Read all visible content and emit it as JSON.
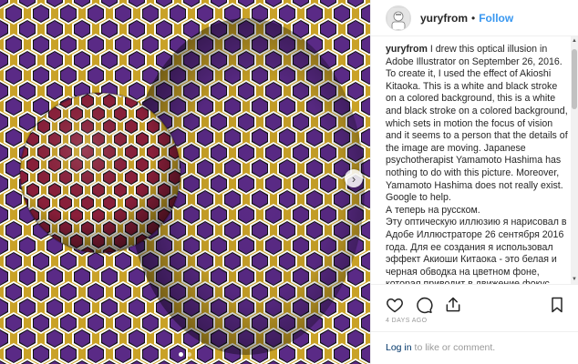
{
  "post": {
    "username": "yuryfrom",
    "separator": "•",
    "follow_label": "Follow",
    "caption_text": "I drew this optical illusion in Adobe Illustrator on September 26, 2016. To create it, I used the effect of Akioshi Kitaoka. This is a white and black stroke on a colored background, this is a white and black stroke on a colored background, which sets in motion the focus of vision and it seems to a person that the details of the image are moving. Japanese psychotherapist Yamamoto Hashima has nothing to do with this picture. Moreover, Yamamoto Hashima does not really exist. Google to help.",
    "caption_ru_1": "А теперь на русском.",
    "caption_ru_2": "Эту оптическую иллюзию я нарисовал в Адобе Иллюстраторе 26 сентября 2016 года. Для ее создания я использовал эффект Акиоши Китаока - это белая и черная обводка на цветном фоне, которая приводит в движение фокус зрения и человеку кажется что детали",
    "timestamp": "4 DAYS AGO",
    "login_link": "Log in",
    "login_rest": " to like or comment."
  },
  "icons": {
    "next": "chevron-right-icon",
    "like": "heart-icon",
    "comment": "comment-icon",
    "share": "share-icon",
    "save": "bookmark-icon"
  },
  "carousel": {
    "total": 2,
    "current": 1
  },
  "colors": {
    "follow_blue": "#3897f0",
    "link_dark": "#003569",
    "purple_tile": "#5a2a86",
    "gold_frame": "#c9a227",
    "sphere_red": "#8a1f3a"
  }
}
